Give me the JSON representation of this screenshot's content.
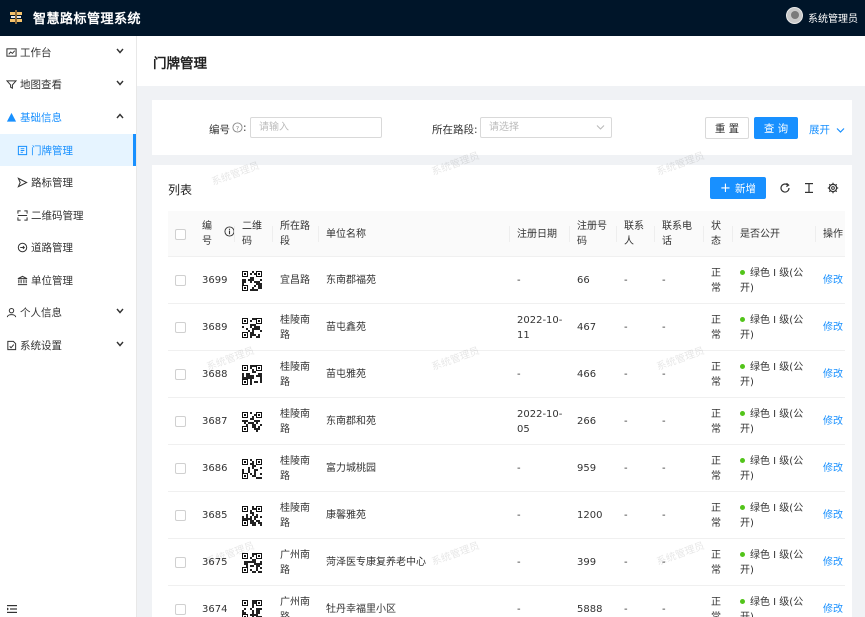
{
  "app": {
    "title": "智慧路标管理系统",
    "user": "系统管理员"
  },
  "sidebar": {
    "items": [
      {
        "label": "工作台",
        "icon": "dashboard-icon",
        "arrow": "down"
      },
      {
        "label": "地图查看",
        "icon": "filter-icon",
        "arrow": "down"
      },
      {
        "label": "基础信息",
        "icon": "warning-icon",
        "arrow": "up",
        "open": true
      },
      {
        "label": "门牌管理",
        "icon": "doorplate-icon",
        "sub": true,
        "active": true
      },
      {
        "label": "路标管理",
        "icon": "send-icon",
        "sub": true
      },
      {
        "label": "二维码管理",
        "icon": "scan-icon",
        "sub": true
      },
      {
        "label": "道路管理",
        "icon": "road-icon",
        "sub": true
      },
      {
        "label": "单位管理",
        "icon": "bank-icon",
        "sub": true
      },
      {
        "label": "个人信息",
        "icon": "user-icon",
        "arrow": "down"
      },
      {
        "label": "系统设置",
        "icon": "setting-icon",
        "arrow": "down"
      }
    ]
  },
  "page": {
    "title": "门牌管理"
  },
  "search": {
    "number_label": "编号",
    "number_placeholder": "请输入",
    "road_label": "所在路段:",
    "road_placeholder": "请选择",
    "reset_label": "重 置",
    "query_label": "查 询",
    "expand_label": "展开"
  },
  "table": {
    "title": "列表",
    "add_label": "新增",
    "columns": {
      "number": "编\n号",
      "qrcode": "二维\n码",
      "road": "所在路\n段",
      "unit": "单位名称",
      "reg_date": "注册日期",
      "reg_no": "注册号\n码",
      "contact": "联系\n人",
      "phone": "联系电\n话",
      "status": "状\n态",
      "public": "是否公开",
      "action": "操作"
    },
    "rows": [
      {
        "number": "3699",
        "road": "宜昌路",
        "unit": "东南郡福苑",
        "reg_date": "-",
        "reg_no": "66",
        "contact": "-",
        "phone": "-",
        "status": "正\n常",
        "public": "绿色 I 级(公\n开)",
        "action": "修改"
      },
      {
        "number": "3689",
        "road": "桂陵南\n路",
        "unit": "苗屯鑫苑",
        "reg_date": "2022-10-\n11",
        "reg_no": "467",
        "contact": "-",
        "phone": "-",
        "status": "正\n常",
        "public": "绿色 I 级(公\n开)",
        "action": "修改"
      },
      {
        "number": "3688",
        "road": "桂陵南\n路",
        "unit": "苗屯雅苑",
        "reg_date": "-",
        "reg_no": "466",
        "contact": "-",
        "phone": "-",
        "status": "正\n常",
        "public": "绿色 I 级(公\n开)",
        "action": "修改"
      },
      {
        "number": "3687",
        "road": "桂陵南\n路",
        "unit": "东南郡和苑",
        "reg_date": "2022-10-\n05",
        "reg_no": "266",
        "contact": "-",
        "phone": "-",
        "status": "正\n常",
        "public": "绿色 I 级(公\n开)",
        "action": "修改"
      },
      {
        "number": "3686",
        "road": "桂陵南\n路",
        "unit": "富力城桃园",
        "reg_date": "-",
        "reg_no": "959",
        "contact": "-",
        "phone": "-",
        "status": "正\n常",
        "public": "绿色 I 级(公\n开)",
        "action": "修改"
      },
      {
        "number": "3685",
        "road": "桂陵南\n路",
        "unit": "康馨雅苑",
        "reg_date": "-",
        "reg_no": "1200",
        "contact": "-",
        "phone": "-",
        "status": "正\n常",
        "public": "绿色 I 级(公\n开)",
        "action": "修改"
      },
      {
        "number": "3675",
        "road": "广州南\n路",
        "unit": "菏泽医专康复养老中心",
        "reg_date": "-",
        "reg_no": "399",
        "contact": "-",
        "phone": "-",
        "status": "正\n常",
        "public": "绿色 I 级(公\n开)",
        "action": "修改"
      },
      {
        "number": "3674",
        "road": "广州南\n路",
        "unit": "牡丹幸福里小区",
        "reg_date": "-",
        "reg_no": "5888",
        "contact": "-",
        "phone": "-",
        "status": "正\n常",
        "public": "绿色 I 级(公\n开)",
        "action": "修改"
      }
    ]
  },
  "watermark": "系统管理员",
  "colors": {
    "primary": "#1890ff",
    "topbar": "#001529",
    "status_dot": "#52c41a"
  }
}
